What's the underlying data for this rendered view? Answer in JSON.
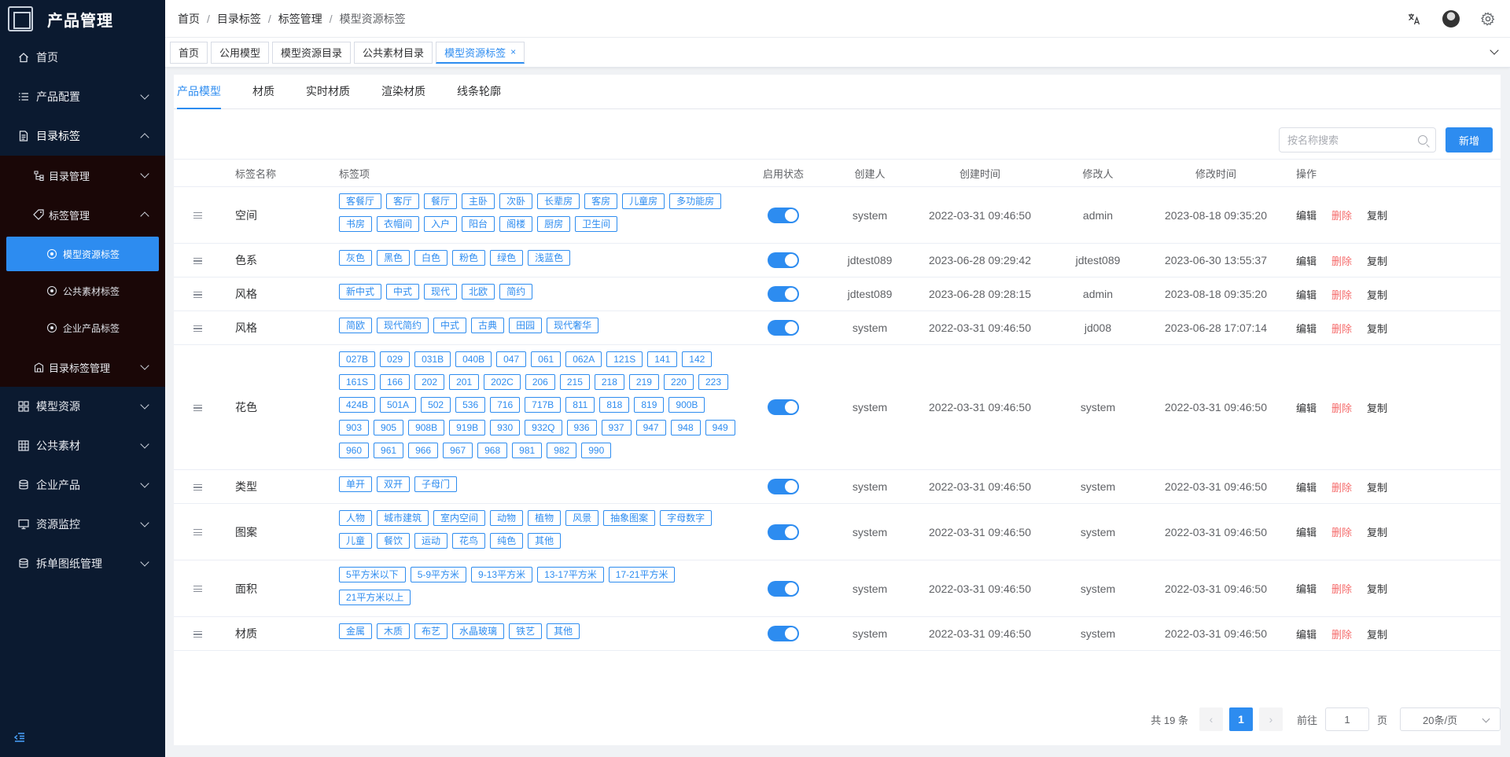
{
  "app": {
    "title": "产品管理"
  },
  "sidebar": {
    "items": [
      {
        "label": "首页",
        "icon": "home-icon"
      },
      {
        "label": "产品配置",
        "icon": "list-icon"
      },
      {
        "label": "目录标签",
        "icon": "document-icon"
      },
      {
        "label": "模型资源",
        "icon": "grid-icon"
      },
      {
        "label": "公共素材",
        "icon": "table-icon"
      },
      {
        "label": "企业产品",
        "icon": "database-icon"
      },
      {
        "label": "资源监控",
        "icon": "monitor-icon"
      },
      {
        "label": "拆单图纸管理",
        "icon": "database-icon"
      }
    ],
    "sub": {
      "catalog_mgmt": "目录管理",
      "tag_mgmt": "标签管理",
      "leaf_model": "模型资源标签",
      "leaf_material": "公共素材标签",
      "leaf_enterprise": "企业产品标签",
      "catalog_tag_mgmt": "目录标签管理"
    },
    "collapse_icon": "collapse-icon"
  },
  "header": {
    "breadcrumb": [
      "首页",
      "目录标签",
      "标签管理",
      "模型资源标签"
    ],
    "separator": "/"
  },
  "tags_view": {
    "tabs": [
      "首页",
      "公用模型",
      "模型资源目录",
      "公共素材目录",
      "模型资源标签"
    ],
    "close": "×"
  },
  "subtabs": [
    "产品模型",
    "材质",
    "实时材质",
    "渲染材质",
    "线条轮廓"
  ],
  "toolbar": {
    "search_placeholder": "按名称搜索",
    "add_label": "新增"
  },
  "table": {
    "headers": {
      "name": "标签名称",
      "tags": "标签项",
      "status": "启用状态",
      "creator": "创建人",
      "ctime": "创建时间",
      "modifier": "修改人",
      "mtime": "修改时间",
      "ops": "操作"
    },
    "ops": {
      "edit": "编辑",
      "delete": "删除",
      "copy": "复制"
    },
    "rows": [
      {
        "name": "空间",
        "tags": [
          "客餐厅",
          "客厅",
          "餐厅",
          "主卧",
          "次卧",
          "长辈房",
          "客房",
          "儿童房",
          "多功能房",
          "书房",
          "衣帽间",
          "入户",
          "阳台",
          "阁楼",
          "厨房",
          "卫生间"
        ],
        "enabled": true,
        "creator": "system",
        "ctime": "2022-03-31 09:46:50",
        "modifier": "admin",
        "mtime": "2023-08-18 09:35:20"
      },
      {
        "name": "色系",
        "tags": [
          "灰色",
          "黑色",
          "白色",
          "粉色",
          "绿色",
          "浅蓝色"
        ],
        "enabled": true,
        "creator": "jdtest089",
        "ctime": "2023-06-28 09:29:42",
        "modifier": "jdtest089",
        "mtime": "2023-06-30 13:55:37"
      },
      {
        "name": "风格",
        "tags": [
          "新中式",
          "中式",
          "现代",
          "北欧",
          "简约"
        ],
        "enabled": true,
        "creator": "jdtest089",
        "ctime": "2023-06-28 09:28:15",
        "modifier": "admin",
        "mtime": "2023-08-18 09:35:20"
      },
      {
        "name": "风格",
        "tags": [
          "简欧",
          "现代简约",
          "中式",
          "古典",
          "田园",
          "现代奢华"
        ],
        "enabled": true,
        "creator": "system",
        "ctime": "2022-03-31 09:46:50",
        "modifier": "jd008",
        "mtime": "2023-06-28 17:07:14"
      },
      {
        "name": "花色",
        "tags": [
          "027B",
          "029",
          "031B",
          "040B",
          "047",
          "061",
          "062A",
          "121S",
          "141",
          "142",
          "161S",
          "166",
          "202",
          "201",
          "202C",
          "206",
          "215",
          "218",
          "219",
          "220",
          "223",
          "424B",
          "501A",
          "502",
          "536",
          "716",
          "717B",
          "811",
          "818",
          "819",
          "900B",
          "903",
          "905",
          "908B",
          "919B",
          "930",
          "932Q",
          "936",
          "937",
          "947",
          "948",
          "949",
          "960",
          "961",
          "966",
          "967",
          "968",
          "981",
          "982",
          "990"
        ],
        "enabled": true,
        "creator": "system",
        "ctime": "2022-03-31 09:46:50",
        "modifier": "system",
        "mtime": "2022-03-31 09:46:50"
      },
      {
        "name": "类型",
        "tags": [
          "单开",
          "双开",
          "子母门"
        ],
        "enabled": true,
        "creator": "system",
        "ctime": "2022-03-31 09:46:50",
        "modifier": "system",
        "mtime": "2022-03-31 09:46:50"
      },
      {
        "name": "图案",
        "tags": [
          "人物",
          "城市建筑",
          "室内空间",
          "动物",
          "植物",
          "风景",
          "抽象图案",
          "字母数字",
          "儿童",
          "餐饮",
          "运动",
          "花鸟",
          "纯色",
          "其他"
        ],
        "enabled": true,
        "creator": "system",
        "ctime": "2022-03-31 09:46:50",
        "modifier": "system",
        "mtime": "2022-03-31 09:46:50"
      },
      {
        "name": "面积",
        "tags": [
          "5平方米以下",
          "5-9平方米",
          "9-13平方米",
          "13-17平方米",
          "17-21平方米",
          "21平方米以上"
        ],
        "enabled": true,
        "creator": "system",
        "ctime": "2022-03-31 09:46:50",
        "modifier": "system",
        "mtime": "2022-03-31 09:46:50"
      },
      {
        "name": "材质",
        "tags": [
          "金属",
          "木质",
          "布艺",
          "水晶玻璃",
          "铁艺",
          "其他"
        ],
        "enabled": true,
        "creator": "system",
        "ctime": "2022-03-31 09:46:50",
        "modifier": "system",
        "mtime": "2022-03-31 09:46:50"
      }
    ]
  },
  "pagination": {
    "total": "共 19 条",
    "current": "1",
    "prev": "‹",
    "next": "›",
    "goto_label": "前往",
    "goto_value": "1",
    "page_unit": "页",
    "page_size": "20条/页"
  },
  "colors": {
    "primary": "#2d8cf0",
    "danger": "#f56c6c",
    "sidebar_bg": "#0b1a30"
  }
}
